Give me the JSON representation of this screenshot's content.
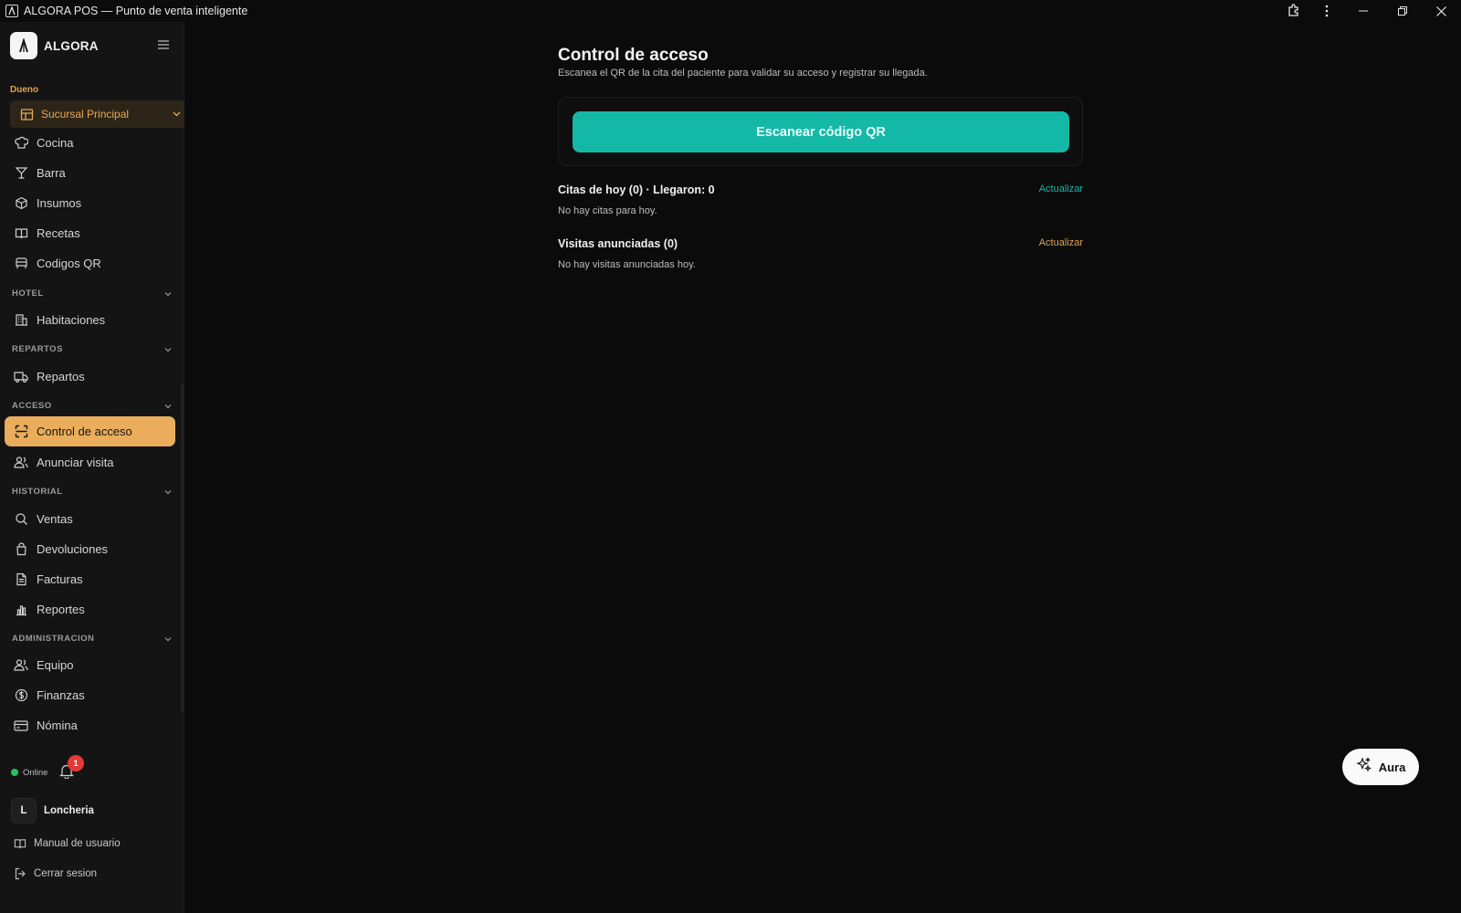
{
  "window": {
    "title": "ALGORA POS — Punto de venta inteligente"
  },
  "sidebar": {
    "brand": "ALGORA",
    "role": "Dueno",
    "branch": "Sucursal Principal",
    "top_items": [
      {
        "label": "Cocina",
        "icon": "chef-hat-icon"
      },
      {
        "label": "Barra",
        "icon": "cocktail-icon"
      },
      {
        "label": "Insumos",
        "icon": "box-icon"
      },
      {
        "label": "Recetas",
        "icon": "book-icon"
      },
      {
        "label": "Codigos QR",
        "icon": "qr-icon"
      }
    ],
    "sections": {
      "hotel": {
        "label": "HOTEL",
        "items": [
          {
            "label": "Habitaciones"
          }
        ]
      },
      "repartos": {
        "label": "REPARTOS",
        "items": [
          {
            "label": "Repartos"
          }
        ]
      },
      "acceso": {
        "label": "ACCESO",
        "items": [
          {
            "label": "Control de acceso"
          },
          {
            "label": "Anunciar visita"
          }
        ]
      },
      "historial": {
        "label": "HISTORIAL",
        "items": [
          {
            "label": "Ventas"
          },
          {
            "label": "Devoluciones"
          },
          {
            "label": "Facturas"
          },
          {
            "label": "Reportes"
          }
        ]
      },
      "administracion": {
        "label": "ADMINISTRACION",
        "items": [
          {
            "label": "Equipo"
          },
          {
            "label": "Finanzas"
          },
          {
            "label": "Nómina"
          }
        ]
      }
    },
    "status": "Online",
    "notifications": "1",
    "user": {
      "initial": "L",
      "name": "Loncheria"
    },
    "manual": "Manual de usuario",
    "logout": "Cerrar sesion"
  },
  "main": {
    "title": "Control de acceso",
    "subtitle": "Escanea el QR de la cita del paciente para validar su acceso y registrar su llegada.",
    "scan_button": "Escanear código QR",
    "citas": {
      "title": "Citas de hoy (0) · Llegaron: 0",
      "empty": "No hay citas para hoy.",
      "refresh": "Actualizar"
    },
    "visitas": {
      "title": "Visitas anunciadas (0)",
      "empty": "No hay visitas anunciadas hoy.",
      "refresh": "Actualizar"
    },
    "aura": "Aura"
  },
  "colors": {
    "accent": "#e9ad5b",
    "teal": "#14b8a6",
    "online": "#22c55e",
    "badge": "#e53935"
  }
}
